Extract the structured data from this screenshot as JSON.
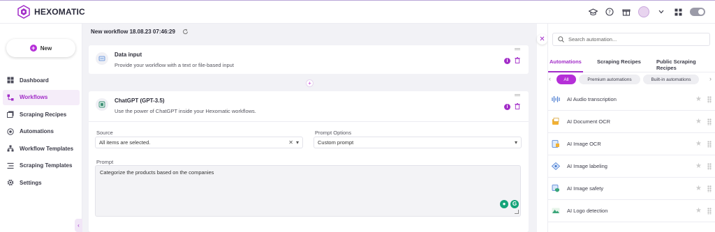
{
  "app": {
    "name": "HEXOMATIC"
  },
  "sidebar": {
    "new_label": "New",
    "items": [
      {
        "label": "Dashboard",
        "icon": "dashboard-icon"
      },
      {
        "label": "Workflows",
        "icon": "workflows-icon",
        "active": true
      },
      {
        "label": "Scraping Recipes",
        "icon": "recipes-icon"
      },
      {
        "label": "Automations",
        "icon": "automations-icon"
      },
      {
        "label": "Workflow Templates",
        "icon": "workflow-templates-icon"
      },
      {
        "label": "Scraping Templates",
        "icon": "scraping-templates-icon"
      },
      {
        "label": "Settings",
        "icon": "settings-icon"
      }
    ]
  },
  "workflow": {
    "title": "New workflow 18.08.23 07:46:29",
    "steps": [
      {
        "title": "Data input",
        "description": "Provide your workflow with a text or file-based input"
      },
      {
        "title": "ChatGPT (GPT-3.5)",
        "description": "Use the power of ChatGPT inside your Hexomatic workflows."
      }
    ],
    "source_label": "Source",
    "source_value": "All items are selected.",
    "prompt_options_label": "Prompt Options",
    "prompt_options_value": "Custom prompt",
    "prompt_label": "Prompt",
    "prompt_value": "Categorize the products based on the companies"
  },
  "panel": {
    "search_placeholder": "Search automation...",
    "tabs": [
      "Automations",
      "Scraping Recipes",
      "Public Scraping Recipes"
    ],
    "chips": [
      "All",
      "Premium automations",
      "Built-in automations"
    ],
    "items": [
      "AI Audio transcription",
      "AI Document OCR",
      "AI Image OCR",
      "AI Image labeling",
      "AI Image safety",
      "AI Logo detection"
    ]
  },
  "colors": {
    "accent": "#a22dc8",
    "accent_strong": "#b52fd8"
  }
}
